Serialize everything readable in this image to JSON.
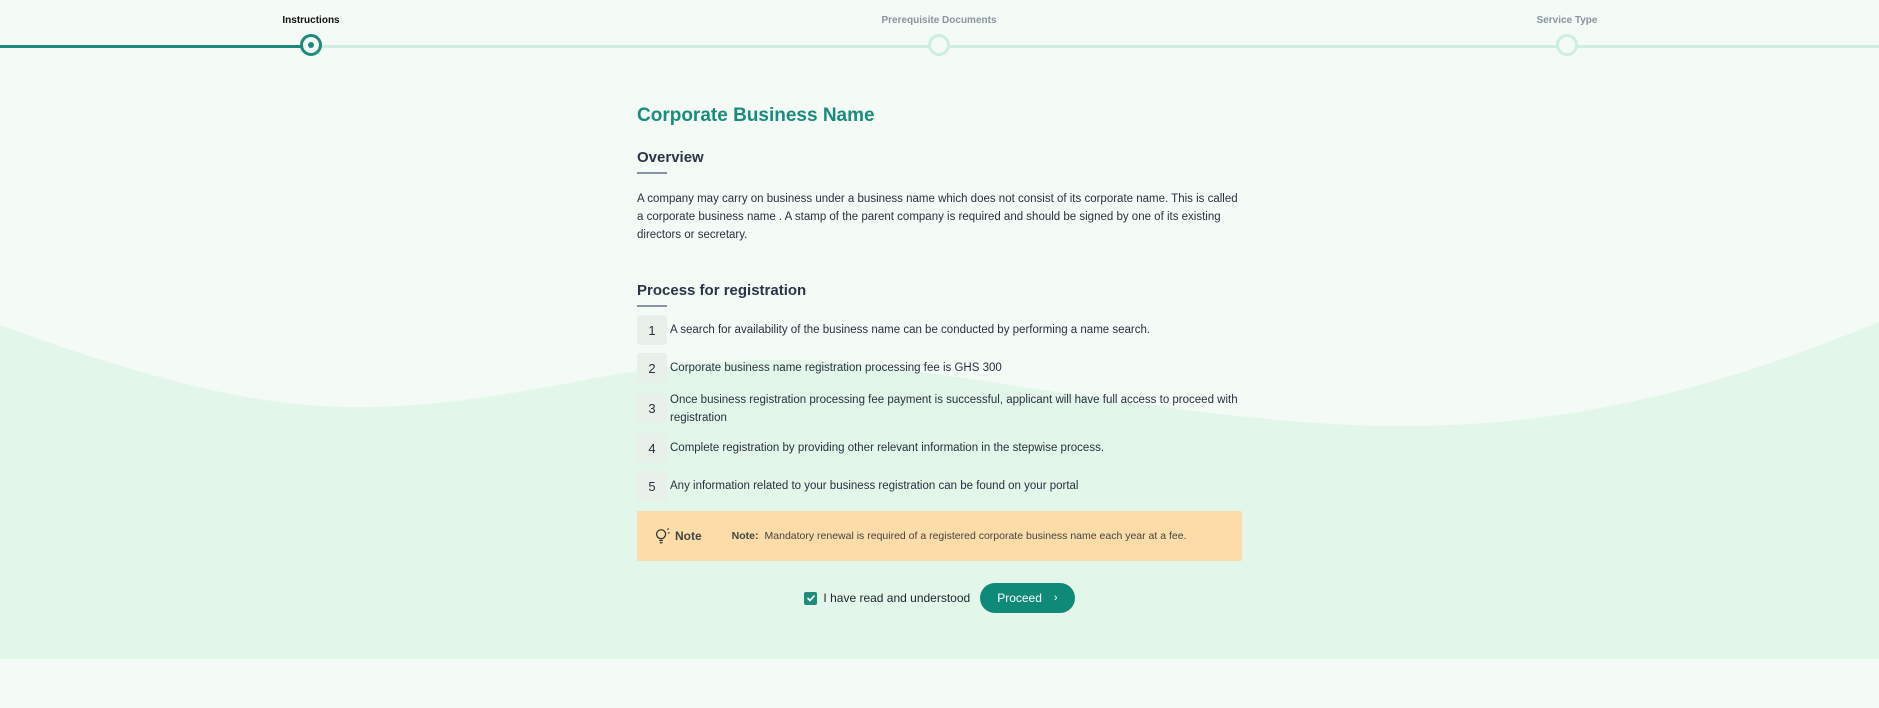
{
  "stepper": {
    "steps": [
      {
        "label": "Instructions",
        "state": "active"
      },
      {
        "label": "Prerequisite Documents",
        "state": "inactive"
      },
      {
        "label": "Service Type",
        "state": "inactive"
      }
    ]
  },
  "main": {
    "title": "Corporate Business Name",
    "overview_heading": "Overview",
    "overview_text": "A company may carry on business under a business name which does not consist of its corporate name. This is called a corporate business name . A stamp of the parent company is required and should be signed by one of its existing directors or secretary.",
    "process_heading": "Process for registration",
    "steps": [
      {
        "number": "1",
        "text": "A search for availability of the business name can be conducted by performing a name search."
      },
      {
        "number": "2",
        "text": "Corporate business name registration processing fee is GHS 300"
      },
      {
        "number": "3",
        "text": "Once business registration processing fee payment is successful, applicant will have full access to proceed with registration"
      },
      {
        "number": "4",
        "text": "Complete registration by providing other relevant information in the stepwise process."
      },
      {
        "number": "5",
        "text": "Any information related to your business registration can be found on your portal"
      }
    ],
    "note": {
      "icon": "lightbulb-icon",
      "label": "Note",
      "prefix": "Note:",
      "text": "Mandatory renewal is required of a registered corporate business name each year at a fee."
    },
    "confirm": {
      "checkbox_checked": true,
      "label": "I have read and understood",
      "proceed_label": "Proceed",
      "proceed_icon": "chevron-right-icon"
    }
  },
  "colors": {
    "accent": "#1d8c7c",
    "background": "#f4faf5",
    "wave": "#e2f6e9",
    "note_bg": "#fddcaa"
  }
}
